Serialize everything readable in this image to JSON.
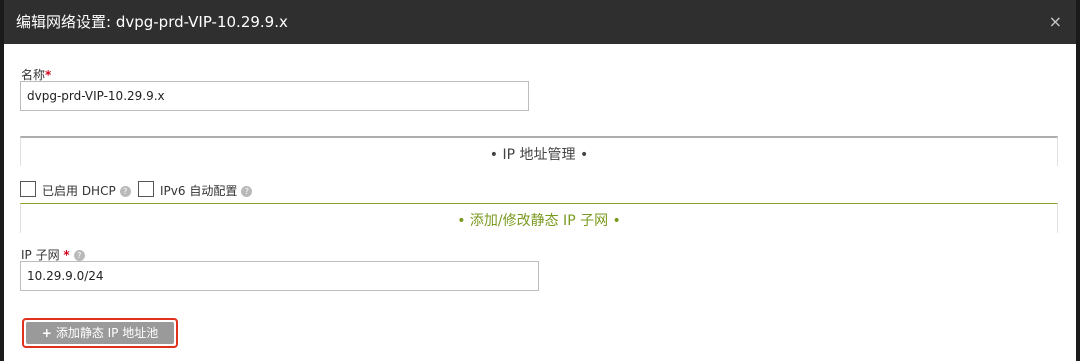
{
  "dialog": {
    "title": "编辑网络设置: dvpg-prd-VIP-10.29.9.x",
    "close_label": "×"
  },
  "name_field": {
    "label": "名称",
    "required_mark": "*",
    "value": "dvpg-prd-VIP-10.29.9.x"
  },
  "ip_management": {
    "heading": "• IP 地址管理 •",
    "dhcp_label": "已启用 DHCP",
    "ipv6_label": "IPv6 自动配置",
    "help_glyph": "?"
  },
  "static_subnet": {
    "heading": "• 添加/修改静态 IP 子网 •",
    "subnet_label": "IP 子网",
    "required_mark": "*",
    "subnet_value": "10.29.9.0/24",
    "add_pool_icon": "+",
    "add_pool_label": "添加静态 IP 地址池"
  },
  "colors": {
    "title_bar": "#2f2f2f",
    "accent_green": "#7a9a1f",
    "required_red": "#d0021b",
    "highlight_red": "#e0301e"
  }
}
